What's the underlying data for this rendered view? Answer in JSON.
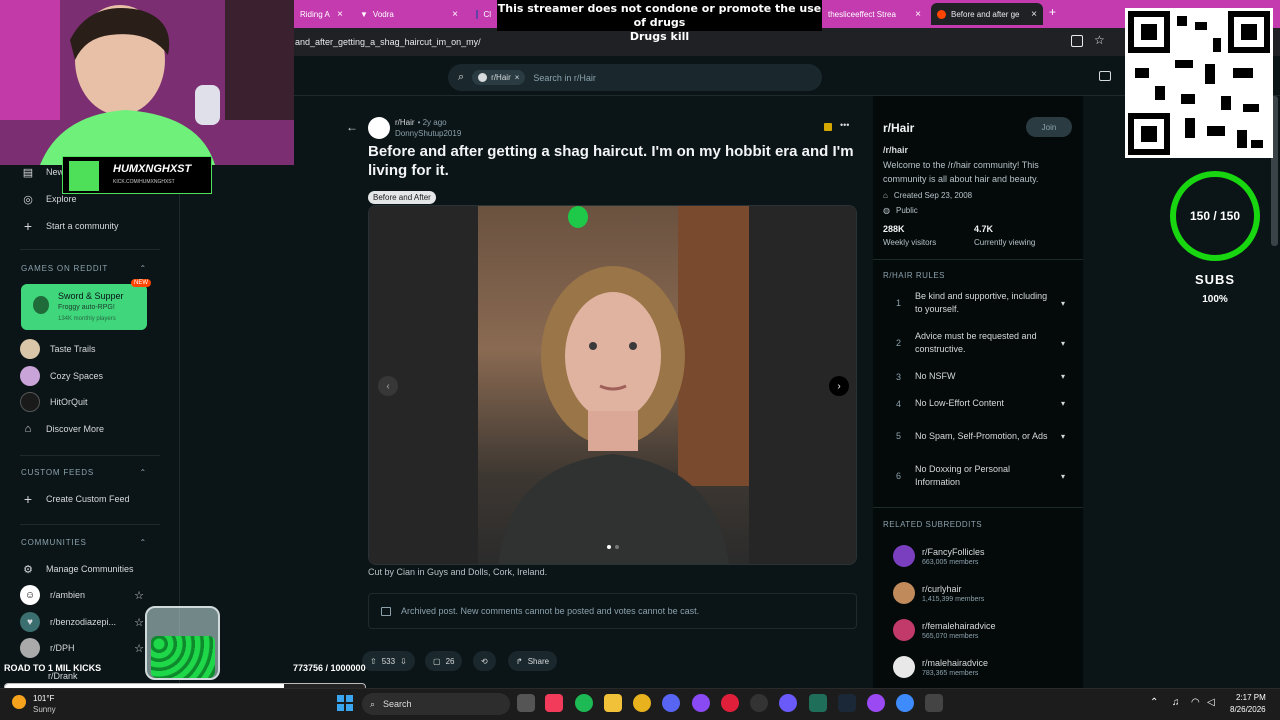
{
  "browser": {
    "tabs": [
      {
        "label": "Riding A",
        "active": false
      },
      {
        "label": "Vodra",
        "active": false
      },
      {
        "label": "Cl",
        "active": false
      },
      {
        "label": "thesliceeffect Strea",
        "active": false
      },
      {
        "label": "Before and after ge",
        "active": true
      }
    ],
    "new_tab": "+",
    "url": "and_after_getting_a_shag_haircut_im_on_my/"
  },
  "search": {
    "chip": "r/Hair",
    "placeholder": "Search in r/Hair"
  },
  "sidebar": {
    "top_items": [
      {
        "label": "New"
      },
      {
        "label": "Explore"
      },
      {
        "label": "Start a community"
      }
    ],
    "games_heading": "GAMES ON REDDIT",
    "game_card": {
      "title": "Sword & Supper",
      "subtitle": "Froggy auto-RPG!",
      "players": "134K monthly players",
      "badge": "NEW"
    },
    "games": [
      {
        "label": "Taste Trails"
      },
      {
        "label": "Cozy Spaces"
      },
      {
        "label": "HitOrQuit"
      },
      {
        "label": "Discover More"
      }
    ],
    "custom_feeds_heading": "CUSTOM FEEDS",
    "create_feed": "Create Custom Feed",
    "communities_heading": "COMMUNITIES",
    "manage_communities": "Manage Communities",
    "communities": [
      {
        "label": "r/ambien"
      },
      {
        "label": "r/benzodiazepi..."
      },
      {
        "label": "r/DPH"
      },
      {
        "label": "r/Drank"
      }
    ]
  },
  "post": {
    "subreddit": "r/Hair",
    "age": "• 2y ago",
    "author": "DonnyShutup2019",
    "title": "Before and after getting a shag haircut. I'm on my hobbit era and I'm living for it.",
    "flair": "Before and After",
    "caption": "Cut by Cian in Guys and Dolls, Cork, Ireland.",
    "archived_notice": "Archived post. New comments cannot be posted and votes cannot be cast.",
    "votes": "533",
    "comments": "26",
    "share_label": "Share",
    "more": "•••"
  },
  "community": {
    "name": "r/Hair",
    "join_label": "Join",
    "short_name": "/r/hair",
    "description": "Welcome to the /r/hair community! This community is all about hair and beauty.",
    "created": "Created Sep 23, 2008",
    "visibility": "Public",
    "weekly_visitors": "288K",
    "weekly_visitors_label": "Weekly visitors",
    "viewing": "4.7K",
    "viewing_label": "Currently viewing",
    "rules_heading": "R/HAIR RULES",
    "rules": [
      {
        "num": "1",
        "text": "Be kind and supportive, including to yourself."
      },
      {
        "num": "2",
        "text": "Advice must be requested and constructive."
      },
      {
        "num": "3",
        "text": "No NSFW"
      },
      {
        "num": "4",
        "text": "No Low-Effort Content"
      },
      {
        "num": "5",
        "text": "No Spam, Self-Promotion, or Ads"
      },
      {
        "num": "6",
        "text": "No Doxxing or Personal Information"
      }
    ],
    "related_heading": "RELATED SUBREDDITS",
    "related": [
      {
        "name": "r/FancyFollicles",
        "members": "663,005 members",
        "color": "#7a3fbf"
      },
      {
        "name": "r/curlyhair",
        "members": "1,415,399 members",
        "color": "#c08a5a"
      },
      {
        "name": "r/femalehairadvice",
        "members": "565,070 members",
        "color": "#c23a6a"
      },
      {
        "name": "r/malehairadvice",
        "members": "783,365 members",
        "color": "#e8e8e8"
      }
    ]
  },
  "overlay": {
    "banner_line1": "This streamer does not condone or promote the use of drugs",
    "banner_line2": "Drugs kill",
    "streamer_name": "HUMXNGHXST",
    "streamer_sub": "KICK.COM/HUMXNGHXST",
    "subs_count": "150 / 150",
    "subs_label": "SUBS",
    "subs_pct": "100%",
    "kicks_label": "ROAD TO 1 MIL KICKS",
    "kicks_count": "773756 / 1000000",
    "kicks_progress": 0.773756
  },
  "taskbar": {
    "weather_temp": "101°F",
    "weather_cond": "Sunny",
    "search_label": "Search",
    "time": "2:17 PM",
    "date": "8/26/2026"
  },
  "colors": {
    "accent_green": "#18d610",
    "tab_pink": "#c43bb0",
    "reddit_bg": "#0b1416"
  }
}
